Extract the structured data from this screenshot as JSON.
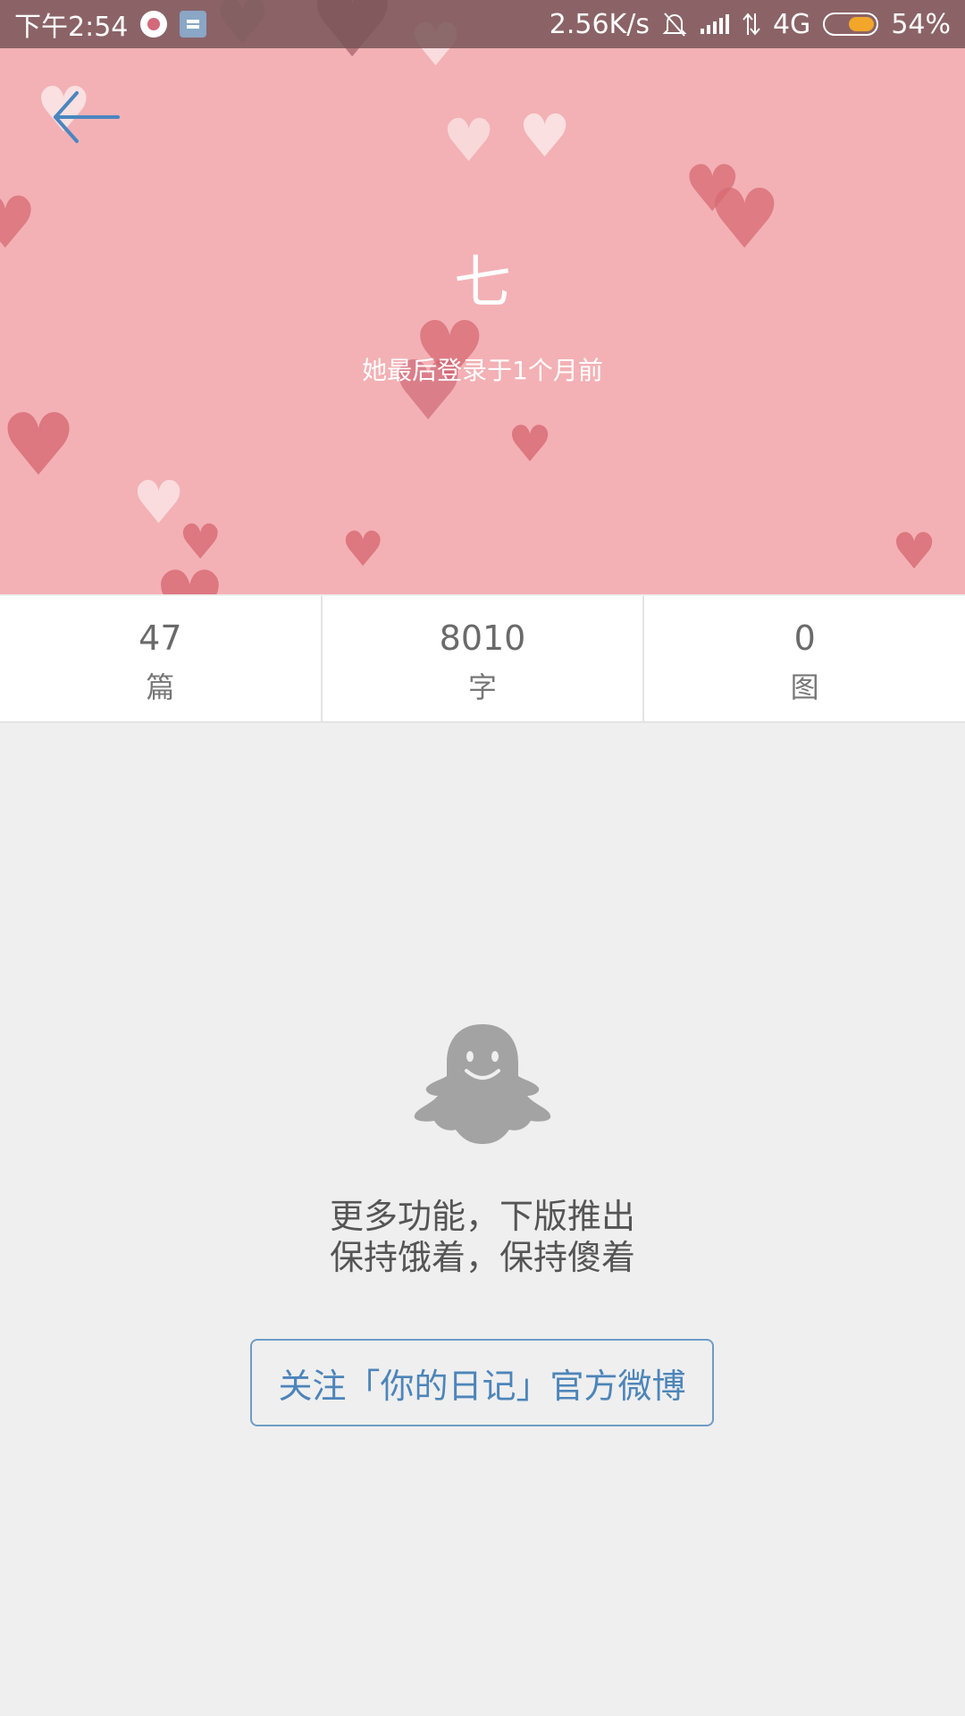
{
  "status_bar": {
    "time": "下午2:54",
    "network_speed": "2.56K/s",
    "network_type": "4G",
    "battery": "54%",
    "battery_level": 0.54
  },
  "profile": {
    "name": "七",
    "last_login": "她最后登录于1个月前"
  },
  "stats": [
    {
      "value": "47",
      "label": "篇"
    },
    {
      "value": "8010",
      "label": "字"
    },
    {
      "value": "0",
      "label": "图"
    }
  ],
  "empty_state": {
    "line1": "更多功能，下版推出",
    "line2": "保持饿着，保持傻着",
    "icon": "ghost-icon"
  },
  "follow_button": {
    "label": "关注「你的日记」官方微博"
  },
  "colors": {
    "header_bg": "#f3b1b5",
    "accent": "#4d85ba",
    "page_bg": "#efefef"
  }
}
